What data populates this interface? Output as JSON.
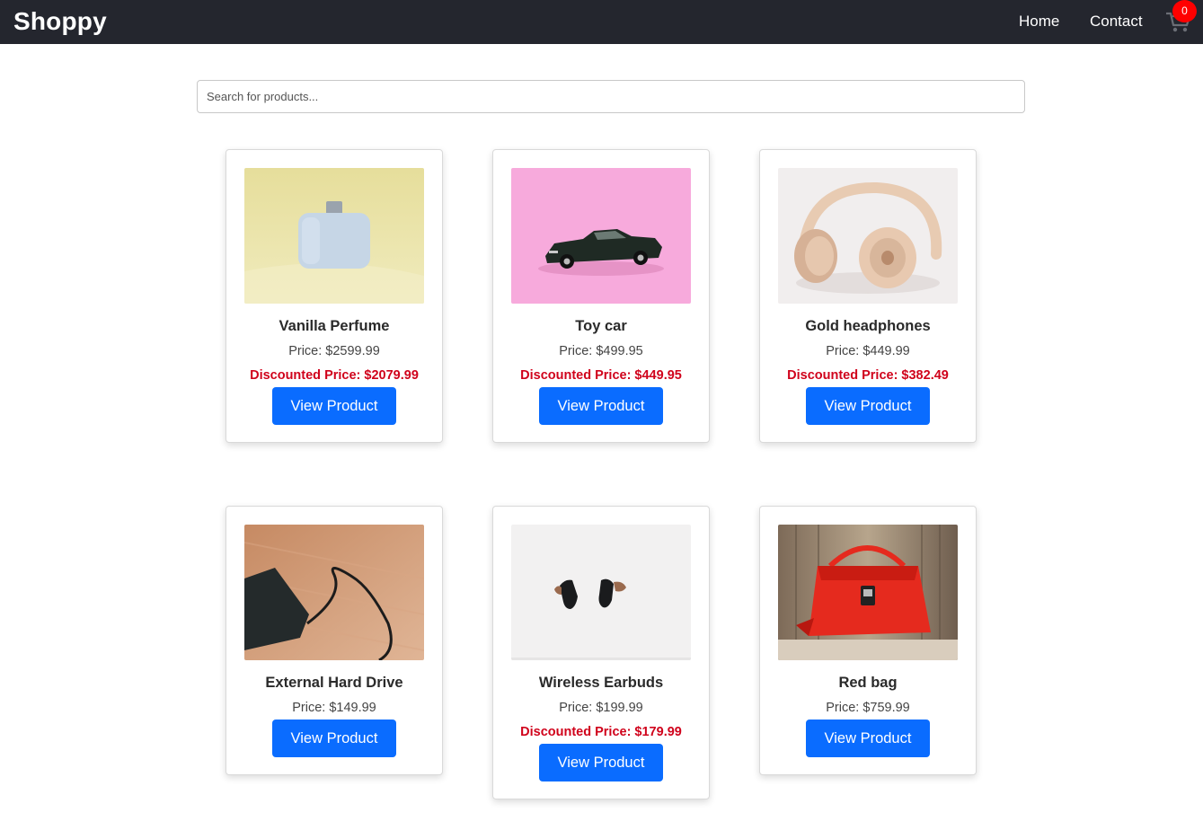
{
  "header": {
    "brand": "Shoppy",
    "nav": {
      "home": "Home",
      "contact": "Contact"
    },
    "cart_count": "0",
    "icons": [
      "cart-icon"
    ]
  },
  "search": {
    "placeholder": "Search for products...",
    "value": ""
  },
  "colors": {
    "navbar": "#24262e",
    "button": "#0a6cff",
    "discount_text": "#d0021b",
    "badge": "#ff0000"
  },
  "products": [
    {
      "name": "Vanilla Perfume",
      "price": "Price: $2599.99",
      "discount": "Discounted Price: $2079.99",
      "button": "View Product"
    },
    {
      "name": "Toy car",
      "price": "Price: $499.95",
      "discount": "Discounted Price: $449.95",
      "button": "View Product"
    },
    {
      "name": "Gold headphones",
      "price": "Price: $449.99",
      "discount": "Discounted Price: $382.49",
      "button": "View Product"
    },
    {
      "name": "External Hard Drive",
      "price": "Price: $149.99",
      "button": "View Product"
    },
    {
      "name": "Wireless Earbuds",
      "price": "Price: $199.99",
      "discount": "Discounted Price: $179.99",
      "button": "View Product"
    },
    {
      "name": "Red bag",
      "price": "Price: $759.99",
      "button": "View Product"
    }
  ]
}
